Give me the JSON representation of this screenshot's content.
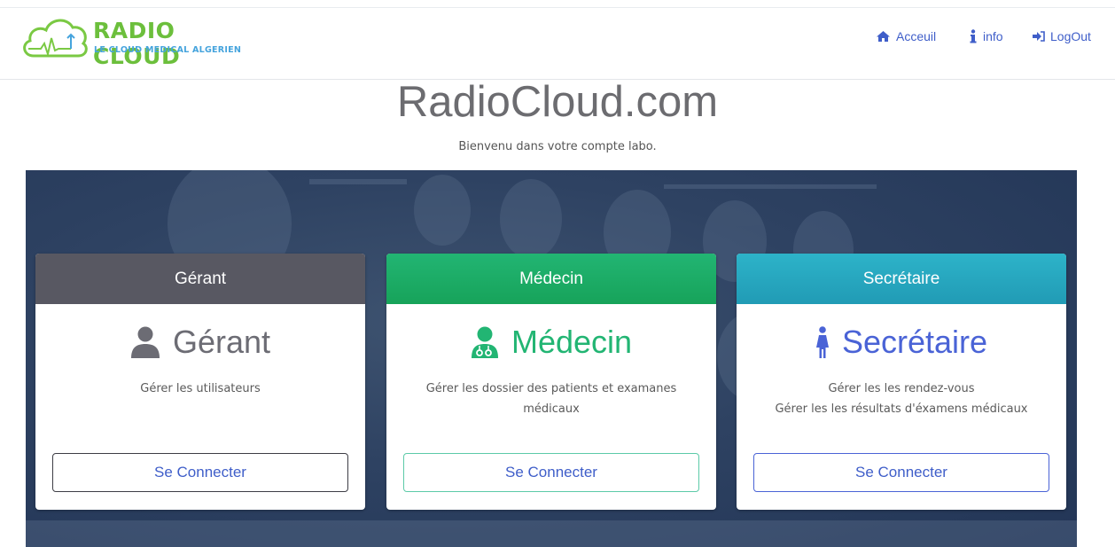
{
  "brand": {
    "title": "RADIO CLOUD",
    "subtitle": "LE CLOUD MEDICAL ALGERIEN"
  },
  "nav": {
    "home_label": "Acceuil",
    "info_label": "info",
    "logout_label": "LogOut"
  },
  "hero": {
    "title": "RadioCloud.com",
    "subtitle": "Bienvenu dans votre compte labo."
  },
  "cards": [
    {
      "header": "Gérant",
      "title": "Gérant",
      "desc1": "Gérer les utilisateurs",
      "desc2": "",
      "button": "Se Connecter",
      "header_color": "#585862",
      "title_color": "#6c6c74",
      "icon": "user-icon"
    },
    {
      "header": "Médecin",
      "title": "Médecin",
      "desc1": "Gérer les dossier des patients et examanes",
      "desc2": "médicaux",
      "button": "Se Connecter",
      "header_color": "#1daa63",
      "title_color": "#22b573",
      "icon": "doctor-icon"
    },
    {
      "header": "Secrétaire",
      "title": "Secrétaire",
      "desc1": "Gérer les les rendez-vous",
      "desc2": "Gérer les les résultats d'éxamens médicaux",
      "button": "Se Connecter",
      "header_color": "#26a4be",
      "title_color": "#4a63d6",
      "icon": "female-icon"
    }
  ]
}
